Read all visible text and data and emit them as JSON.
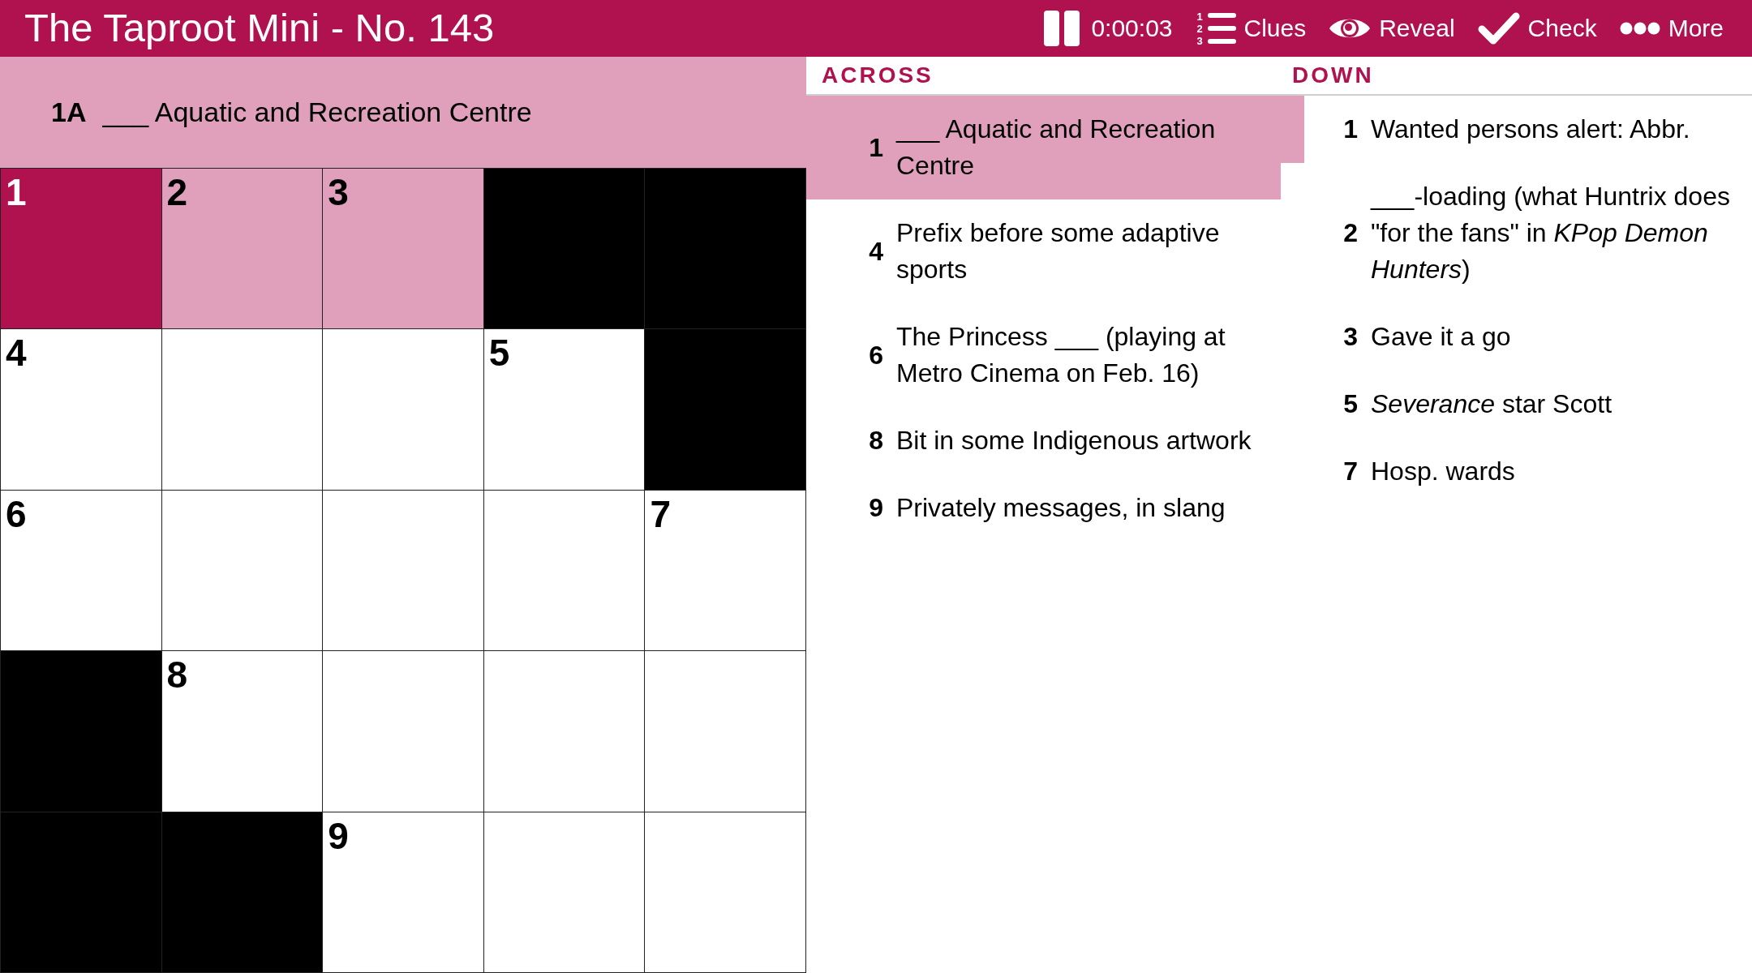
{
  "header": {
    "title": "The Taproot Mini - No. 143",
    "timer": "0:00:03",
    "tools": [
      {
        "kind": "clues",
        "label": "Clues",
        "icon_digits": [
          "1",
          "2",
          "3"
        ]
      },
      {
        "kind": "reveal",
        "label": "Reveal"
      },
      {
        "kind": "check",
        "label": "Check"
      },
      {
        "kind": "more",
        "label": "More"
      }
    ]
  },
  "current_clue": {
    "number": "1A",
    "text": "___ Aquatic and Recreation Centre"
  },
  "grid": {
    "rows": [
      [
        {
          "kind": "letter",
          "number": "1",
          "selected": true
        },
        {
          "kind": "letter",
          "number": "2",
          "selected": false,
          "highlighted": true
        },
        {
          "kind": "letter",
          "number": "3",
          "selected": false,
          "highlighted": true
        },
        {
          "kind": "block"
        },
        {
          "kind": "block"
        }
      ],
      [
        {
          "kind": "letter",
          "number": "4",
          "selected": false,
          "highlighted": false
        },
        {
          "kind": "letter",
          "selected": false,
          "highlighted": false
        },
        {
          "kind": "letter",
          "selected": false,
          "highlighted": false
        },
        {
          "kind": "letter",
          "number": "5",
          "selected": false,
          "highlighted": false
        },
        {
          "kind": "block"
        }
      ],
      [
        {
          "kind": "letter",
          "number": "6",
          "selected": false,
          "highlighted": false
        },
        {
          "kind": "letter",
          "selected": false,
          "highlighted": false
        },
        {
          "kind": "letter",
          "selected": false,
          "highlighted": false
        },
        {
          "kind": "letter",
          "selected": false,
          "highlighted": false
        },
        {
          "kind": "letter",
          "number": "7",
          "selected": false,
          "highlighted": false
        }
      ],
      [
        {
          "kind": "block"
        },
        {
          "kind": "letter",
          "number": "8",
          "selected": false,
          "highlighted": false
        },
        {
          "kind": "letter",
          "selected": false,
          "highlighted": false
        },
        {
          "kind": "letter",
          "selected": false,
          "highlighted": false
        },
        {
          "kind": "letter",
          "selected": false,
          "highlighted": false
        }
      ],
      [
        {
          "kind": "block"
        },
        {
          "kind": "block"
        },
        {
          "kind": "letter",
          "number": "9",
          "selected": false,
          "highlighted": false
        },
        {
          "kind": "letter",
          "selected": false,
          "highlighted": false
        },
        {
          "kind": "letter",
          "selected": false,
          "highlighted": false
        }
      ]
    ]
  },
  "across": {
    "heading": "ACROSS",
    "clues": [
      {
        "number": "1",
        "text": "___ Aquatic and Recreation Centre",
        "selected": true,
        "crossing": false
      },
      {
        "number": "4",
        "text": "Prefix before some adaptive sports",
        "selected": false,
        "crossing": false
      },
      {
        "number": "6",
        "text": "The Princess ___ (playing at Metro Cinema on Feb. 16)",
        "selected": false,
        "crossing": false
      },
      {
        "number": "8",
        "text": "Bit in some Indigenous artwork",
        "selected": false,
        "crossing": false
      },
      {
        "number": "9",
        "text": "Privately messages, in slang",
        "selected": false,
        "crossing": false
      }
    ]
  },
  "down": {
    "heading": "DOWN",
    "clues": [
      {
        "number": "1",
        "text": "Wanted persons alert: Abbr.",
        "selected": false,
        "crossing": true
      },
      {
        "number": "2",
        "text": "___-loading (what Huntrix does \"for the fans\" in *KPop Demon Hunters*)",
        "selected": false,
        "crossing": false
      },
      {
        "number": "3",
        "text": "Gave it a go",
        "selected": false,
        "crossing": false
      },
      {
        "number": "5",
        "text": "*Severance* star Scott",
        "selected": false,
        "crossing": false
      },
      {
        "number": "7",
        "text": "Hosp. wards",
        "selected": false,
        "crossing": false
      }
    ]
  }
}
